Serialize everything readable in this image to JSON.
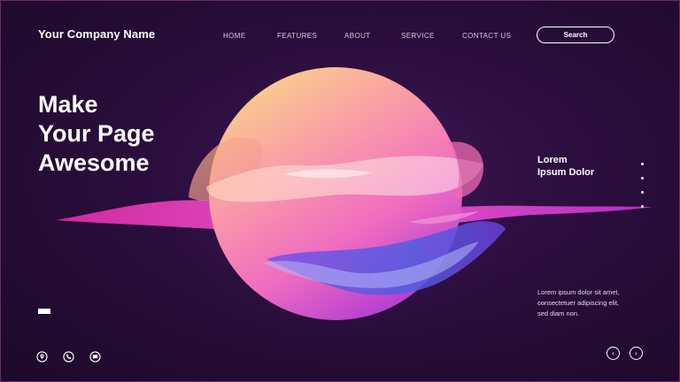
{
  "header": {
    "brand": "Your Company Name",
    "nav": [
      "HOME",
      "FEATURES",
      "ABOUT",
      "SERVICE",
      "CONTACT US"
    ],
    "search_label": "Search"
  },
  "hero": {
    "lines": [
      "Make",
      "Your Page",
      "Awesome"
    ]
  },
  "side": {
    "title_lines": [
      "Lorem",
      "Ipsum Dolor"
    ],
    "body_lines": [
      "Lorem ipsum dolor sit amet,",
      "consectetuer adipiscing elit,",
      "sed diam non."
    ],
    "page_dots": 4
  },
  "footer": {
    "icons": [
      "location-pin-icon",
      "phone-icon",
      "message-icon"
    ],
    "arrows": [
      "‹",
      "›"
    ]
  },
  "colors": {
    "background": "#2a0d3c",
    "planet_top": "#f7c987",
    "planet_mid": "#f77fb0",
    "planet_bottom": "#c53fd8",
    "wave_magenta": "#e43bb5",
    "wave_blue": "#5a5ee0"
  }
}
